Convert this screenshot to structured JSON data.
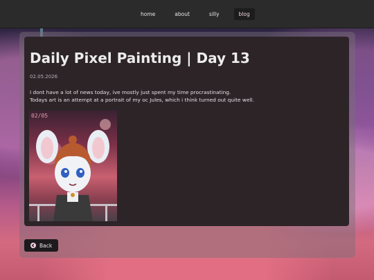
{
  "nav": {
    "items": [
      {
        "label": "home"
      },
      {
        "label": "about"
      },
      {
        "label": "silly"
      },
      {
        "label": "blog",
        "active": true
      }
    ]
  },
  "post": {
    "title": "Daily Pixel Painting | Day 13",
    "date": "02.05.2026",
    "paragraph_1": "I dont have a lot of news today, ive mostly just spent my time procrastinating.",
    "paragraph_2": "Todays art is an attempt at a portrait of my oc Jules, which i think turned out quite well.",
    "image_text": "02/05"
  },
  "back_button": {
    "label": "Back",
    "icon": "arrow-left-circle-icon"
  },
  "colors": {
    "accent": "#f2d0dc",
    "card": "#2d2428",
    "nav": "#2b2b2b"
  }
}
